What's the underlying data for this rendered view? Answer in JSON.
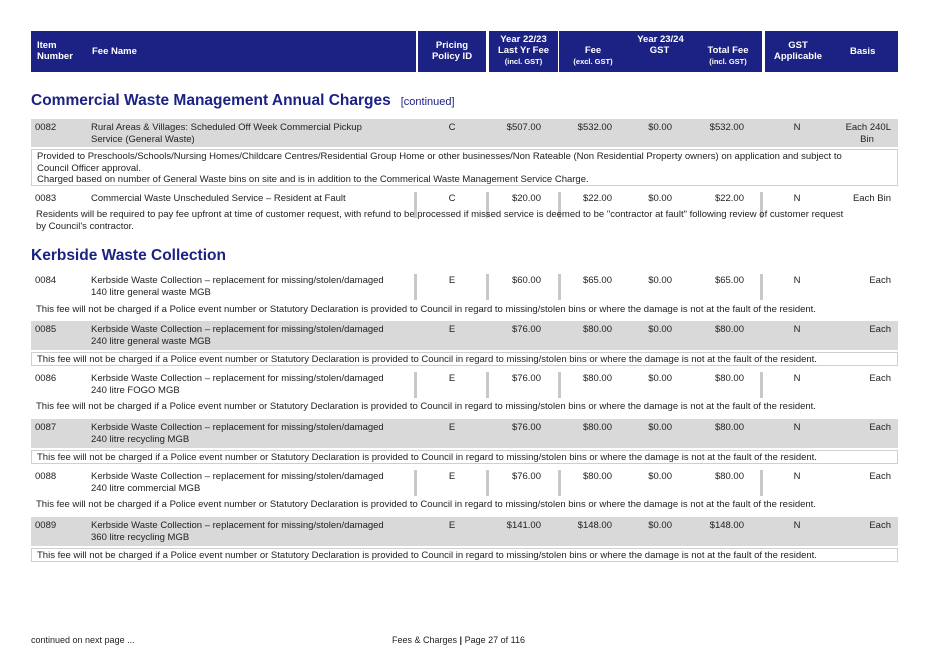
{
  "header": {
    "item_number": [
      "Item",
      "Number"
    ],
    "fee_name": "Fee Name",
    "pricing_policy": [
      "Pricing",
      "Policy ID"
    ],
    "year_prev": {
      "label": "Year 22/23",
      "sub1": "Last Yr Fee",
      "sub2": "(incl. GST)"
    },
    "year_cur": {
      "label": "Year 23/24",
      "fee": "Fee",
      "fee_sub": "(excl. GST)",
      "gst": "GST",
      "total": "Total Fee",
      "total_sub": "(incl. GST)"
    },
    "gst_applicable": [
      "GST",
      "Applicable"
    ],
    "basis": "Basis"
  },
  "sections": [
    {
      "title": "Commercial Waste Management Annual Charges",
      "note": "[continued]"
    },
    {
      "title": "Kerbside Waste Collection"
    }
  ],
  "rows": [
    {
      "num": "0082",
      "name": [
        "Rural Areas & Villages: Scheduled Off Week Commercial Pickup",
        "Service (General Waste)"
      ],
      "policy": "C",
      "last": "$507.00",
      "fee": "$532.00",
      "gst": "$0.00",
      "total": "$532.00",
      "applicable": "N",
      "basis": [
        "Each 240L",
        "Bin"
      ],
      "desc": [
        "Provided to Preschools/Schools/Nursing Homes/Childcare Centres/Residential Group Home or other businesses/Non Rateable (Non Residential Property owners) on application and subject to",
        "Council Officer approval.",
        "Charged based on number of General Waste bins on site and is in addition to the Commerical Waste Management Service Charge."
      ]
    },
    {
      "num": "0083",
      "name": [
        "Commercial Waste Unscheduled Service – Resident at Fault",
        ""
      ],
      "policy": "C",
      "last": "$20.00",
      "fee": "$22.00",
      "gst": "$0.00",
      "total": "$22.00",
      "applicable": "N",
      "basis": [
        "Each Bin",
        ""
      ],
      "desc": [
        "Residents will be required to pay fee upfront at time of customer request, with refund to be processed if missed service is deemed to be \"contractor at fault\" following review of customer request",
        "by Council's contractor."
      ]
    },
    {
      "num": "0084",
      "name": [
        "Kerbside Waste Collection – replacement for missing/stolen/damaged",
        "140 litre general waste MGB"
      ],
      "policy": "E",
      "last": "$60.00",
      "fee": "$65.00",
      "gst": "$0.00",
      "total": "$65.00",
      "applicable": "N",
      "basis": [
        "Each",
        ""
      ],
      "desc": [
        "This fee will not be charged if a Police event number or Statutory Declaration is provided to Council in regard to missing/stolen bins or where the damage is not at the fault of the resident."
      ]
    },
    {
      "num": "0085",
      "name": [
        "Kerbside Waste Collection – replacement for missing/stolen/damaged",
        "240 litre general waste MGB"
      ],
      "policy": "E",
      "last": "$76.00",
      "fee": "$80.00",
      "gst": "$0.00",
      "total": "$80.00",
      "applicable": "N",
      "basis": [
        "Each",
        ""
      ],
      "desc": [
        "This fee will not be charged if a Police event number or Statutory Declaration is provided to Council in regard to missing/stolen bins or where the damage is not at the fault of the resident."
      ]
    },
    {
      "num": "0086",
      "name": [
        "Kerbside Waste Collection – replacement for missing/stolen/damaged",
        "240 litre FOGO MGB"
      ],
      "policy": "E",
      "last": "$76.00",
      "fee": "$80.00",
      "gst": "$0.00",
      "total": "$80.00",
      "applicable": "N",
      "basis": [
        "Each",
        ""
      ],
      "desc": [
        "This fee will not be charged if a Police event number or Statutory Declaration is provided to Council in regard to missing/stolen bins or where the damage is not at the fault of the resident."
      ]
    },
    {
      "num": "0087",
      "name": [
        "Kerbside Waste Collection – replacement for missing/stolen/damaged",
        "240 litre recycling MGB"
      ],
      "policy": "E",
      "last": "$76.00",
      "fee": "$80.00",
      "gst": "$0.00",
      "total": "$80.00",
      "applicable": "N",
      "basis": [
        "Each",
        ""
      ],
      "desc": [
        "This fee will not be charged if a Police event number or Statutory Declaration is provided to Council in regard to missing/stolen bins or where the damage is not at the fault of the resident."
      ]
    },
    {
      "num": "0088",
      "name": [
        "Kerbside Waste Collection – replacement for missing/stolen/damaged",
        "240 litre commercial MGB"
      ],
      "policy": "E",
      "last": "$76.00",
      "fee": "$80.00",
      "gst": "$0.00",
      "total": "$80.00",
      "applicable": "N",
      "basis": [
        "Each",
        ""
      ],
      "desc": [
        "This fee will not be charged if a Police event number or Statutory Declaration is provided to Council in regard to missing/stolen bins or where the damage is not at the fault of the resident."
      ]
    },
    {
      "num": "0089",
      "name": [
        "Kerbside Waste Collection – replacement for missing/stolen/damaged",
        "360 litre recycling MGB"
      ],
      "policy": "E",
      "last": "$141.00",
      "fee": "$148.00",
      "gst": "$0.00",
      "total": "$148.00",
      "applicable": "N",
      "basis": [
        "Each",
        ""
      ],
      "desc": [
        "This fee will not be charged if a Police event number or Statutory Declaration is provided to Council in regard to missing/stolen bins or where the damage is not at the fault of the resident."
      ]
    }
  ],
  "footer": {
    "left": "continued on next page ...",
    "center_a": "Fees & Charges",
    "center_sep": "|",
    "center_b": "Page 27 of 116"
  }
}
